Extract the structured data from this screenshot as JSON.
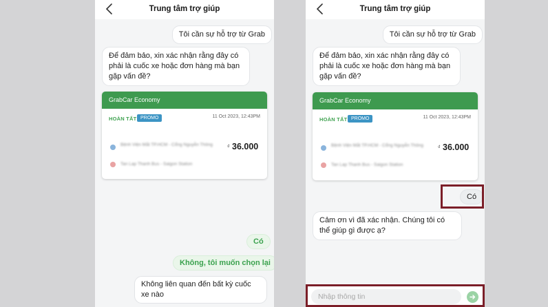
{
  "header": {
    "title": "Trung tâm trợ giúp"
  },
  "chat": {
    "user_request": "Tôi cần sự hỗ trợ từ Grab",
    "bot_confirm_question": "Để đảm bảo, xin xác nhận rằng đây có phải là cuốc xe hoặc đơn hàng mà bạn gặp vấn đề?",
    "bot_followup": "Cảm ơn vì đã xác nhận. Chúng tôi có thể giúp gì được ạ?",
    "user_reply": "Có"
  },
  "ride_card": {
    "service": "GrabCar Economy",
    "status": "HOÀN TẤT",
    "promo_badge": "PROMO",
    "datetime": "11 Oct 2023, 12:43PM",
    "currency_symbol": "₫",
    "price": "36.000",
    "pickup": "Bệnh Viện Mắt TP.HCM - Cổng Nguyễn Thông",
    "dropoff": "Tan Lap Thanh Bus - Saigon Station"
  },
  "quick_replies": [
    {
      "label": "Có"
    },
    {
      "label": "Không, tôi muốn chọn lại"
    },
    {
      "label": "Không liên quan đến bất kỳ cuốc xe nào"
    }
  ],
  "input": {
    "placeholder": "Nhập thông tin"
  },
  "colors": {
    "brand_green": "#3e9a4f",
    "promo_blue": "#3c94c4",
    "highlight_border": "#7b1e28"
  },
  "icons": {
    "back": "chevron-left-icon",
    "send": "send-arrow-icon"
  }
}
